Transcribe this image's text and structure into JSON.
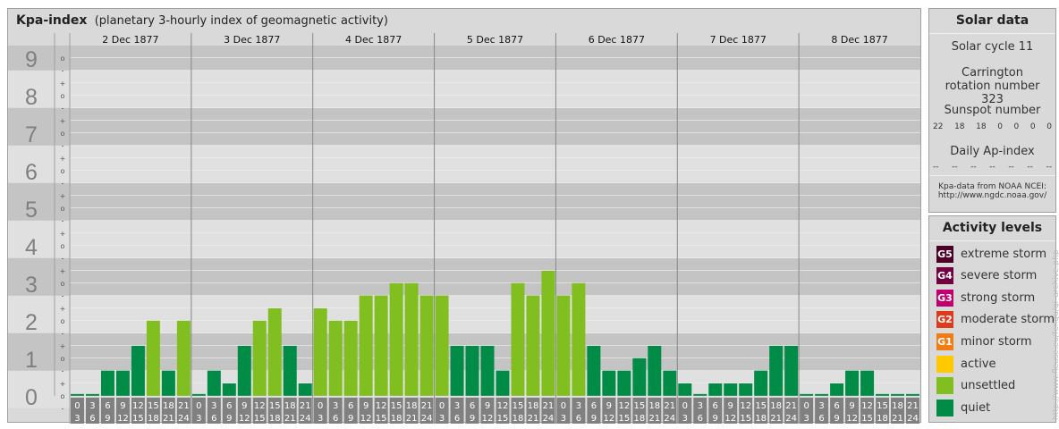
{
  "title": {
    "main": "Kpa-index",
    "sub": "(planetary 3-hourly index of geomagnetic activity)"
  },
  "chart_data": {
    "type": "bar",
    "days": [
      "2 Dec 1877",
      "3 Dec 1877",
      "4 Dec 1877",
      "5 Dec 1877",
      "6 Dec 1877",
      "7 Dec 1877",
      "8 Dec 1877"
    ],
    "interval_labels": [
      [
        "0",
        "3"
      ],
      [
        "3",
        "6"
      ],
      [
        "6",
        "9"
      ],
      [
        "9",
        "12"
      ],
      [
        "12",
        "15"
      ],
      [
        "15",
        "18"
      ],
      [
        "18",
        "21"
      ],
      [
        "21",
        "24"
      ]
    ],
    "y_ticks": [
      "0",
      "1",
      "2",
      "3",
      "4",
      "5",
      "6",
      "7",
      "8",
      "9"
    ],
    "sub_ticks": [
      "-",
      "o",
      "+"
    ],
    "ylim": [
      0,
      9.33
    ],
    "values": [
      [
        0,
        0,
        0.67,
        0.67,
        1.33,
        2,
        0.67,
        2
      ],
      [
        0,
        0.67,
        0.33,
        1.33,
        2,
        2.33,
        1.33,
        0.33
      ],
      [
        2.33,
        2,
        2,
        2.67,
        2.67,
        3,
        3,
        2.67
      ],
      [
        2.67,
        1.33,
        1.33,
        1.33,
        0.67,
        3,
        2.67,
        3.33
      ],
      [
        2.67,
        3,
        1.33,
        0.67,
        0.67,
        1,
        1.33,
        0.67
      ],
      [
        0.33,
        0,
        0.33,
        0.33,
        0.33,
        0.67,
        1.33,
        1.33
      ],
      [
        0,
        0,
        0.33,
        0.67,
        0.67,
        0,
        0,
        0
      ]
    ],
    "colors": {
      "quiet": "#008c46",
      "unsettled": "#80bf1f",
      "panel": "#d9d9d9",
      "band_dark": "#c4c4c4",
      "band_light": "#e0e0e0",
      "axis_digit": "#7f7f7f",
      "interval_box": "#808080"
    }
  },
  "solar": {
    "title": "Solar data",
    "cycle": "Solar cycle 11",
    "carrington": "Carrington rotation number 323",
    "sunspot_title": "Sunspot number",
    "sunspot_values": [
      "22",
      "18",
      "18",
      "0",
      "0",
      "0",
      "0"
    ],
    "ap_title": "Daily Ap-index",
    "ap_values": [
      "--",
      "--",
      "--",
      "--",
      "--",
      "--",
      "--"
    ],
    "source_line1": "Kpa-data from NOAA NCEI:",
    "source_line2": "http://www.ngdc.noaa.gov/"
  },
  "activity": {
    "title": "Activity levels",
    "levels": [
      {
        "code": "G5",
        "label": "extreme storm",
        "color": "#4d0026"
      },
      {
        "code": "G4",
        "label": "severe storm",
        "color": "#730040"
      },
      {
        "code": "G3",
        "label": "strong storm",
        "color": "#c0006e"
      },
      {
        "code": "G2",
        "label": "moderate storm",
        "color": "#e03a1e"
      },
      {
        "code": "G1",
        "label": "minor storm",
        "color": "#f07d14"
      },
      {
        "code": "",
        "label": "active",
        "color": "#ffc800"
      },
      {
        "code": "",
        "label": "unsettled",
        "color": "#80bf1f"
      },
      {
        "code": "",
        "label": "quiet",
        "color": "#008c46"
      }
    ]
  },
  "watermark": "http://www.fleuse.eu/fengu/gi_archive.php"
}
